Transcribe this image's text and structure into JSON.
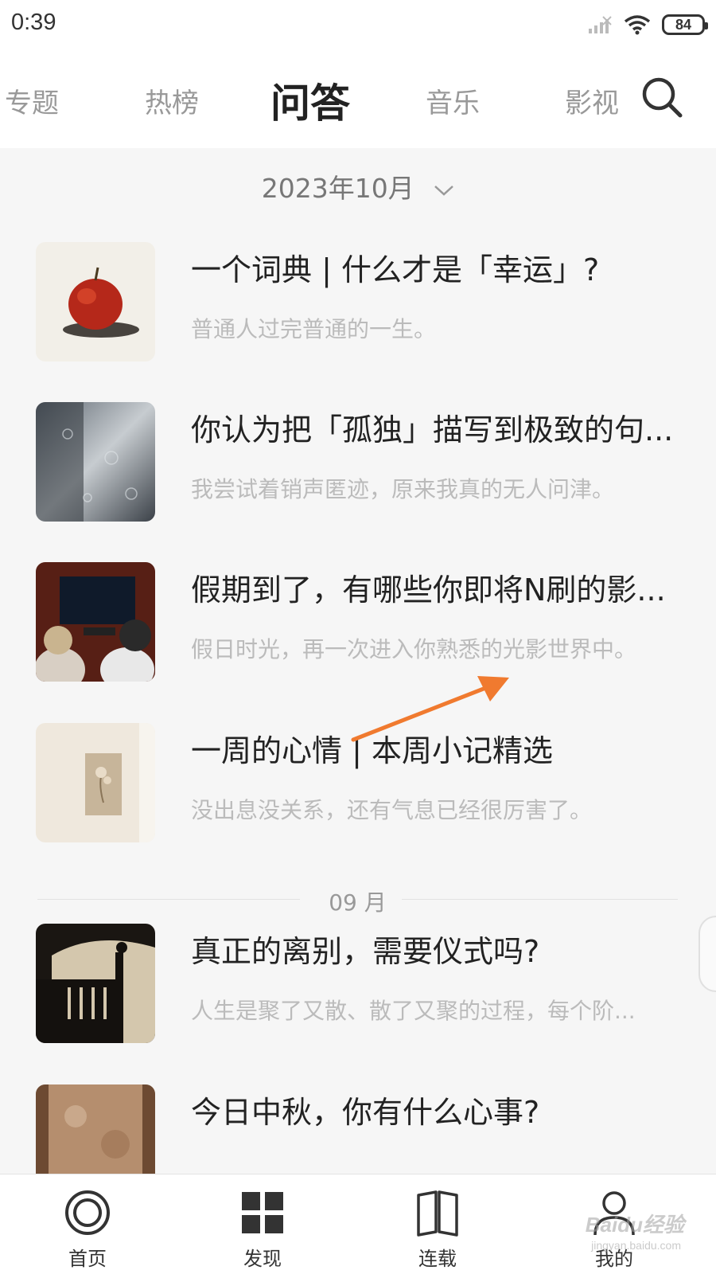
{
  "status_bar": {
    "time": "0:39",
    "battery": "84"
  },
  "top_nav": {
    "tabs": [
      {
        "label": "专题",
        "active": false
      },
      {
        "label": "热榜",
        "active": false
      },
      {
        "label": "问答",
        "active": true
      },
      {
        "label": "音乐",
        "active": false
      },
      {
        "label": "影视",
        "active": false
      }
    ]
  },
  "month_selector": {
    "label": "2023年10月"
  },
  "articles": [
    {
      "title": "一个词典 | 什么才是「幸运」?",
      "subtitle": "普通人过完普通的一生。"
    },
    {
      "title": "你认为把「孤独」描写到极致的句...",
      "subtitle": "我尝试着销声匿迹，原来我真的无人问津。"
    },
    {
      "title": "假期到了，有哪些你即将N刷的影...",
      "subtitle": "假日时光，再一次进入你熟悉的光影世界中。"
    },
    {
      "title": "一周的心情 | 本周小记精选",
      "subtitle": "没出息没关系，还有气息已经很厉害了。"
    },
    {
      "title": "真正的离别，需要仪式吗?",
      "subtitle": "人生是聚了又散、散了又聚的过程，每个阶..."
    },
    {
      "title": "今日中秋，你有什么心事?",
      "subtitle": ""
    }
  ],
  "section_divider": {
    "label": "09 月"
  },
  "bottom_nav": {
    "items": [
      {
        "label": "首页",
        "icon": "home-circle-icon"
      },
      {
        "label": "发现",
        "icon": "grid-icon"
      },
      {
        "label": "连载",
        "icon": "book-icon"
      },
      {
        "label": "我的",
        "icon": "person-icon"
      }
    ]
  },
  "watermark": {
    "text": "Baidu经验",
    "sub": "jingyan.baidu.com"
  },
  "colors": {
    "annotation_arrow": "#f07a2f",
    "title_text": "#222222",
    "subtitle_text": "#bbbbbb"
  }
}
